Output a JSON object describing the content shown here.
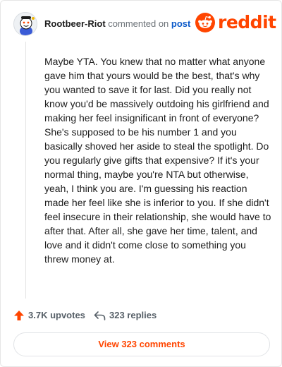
{
  "colors": {
    "brand": "#ff4500",
    "link": "#0b59c9",
    "muted": "#576068"
  },
  "header": {
    "avatar_icon": "snoo-avatar-icon",
    "author": "Rootbeer-Riot",
    "commented_text": "commented on",
    "post_link": "post",
    "logo_icon": "reddit-snoo-icon",
    "logo_text": "reddit"
  },
  "comment": {
    "body": "Maybe YTA. You knew that no matter what anyone gave him that yours would be the best, that's why you wanted to save it for last. Did you really not know you'd be massively outdoing his girlfriend and making her feel insignificant in front of everyone? She's supposed to be his number 1 and you basically shoved her aside to steal the spotlight. Do you regularly give gifts that expensive? If it's your normal thing, maybe you're NTA but otherwise, yeah, I think you are. I'm guessing his reaction made her feel like she is inferior to you. If she didn't feel insecure in their relationship, she would have to after that. After all, she gave her time, talent, and love and it didn't come close to something you threw money at."
  },
  "actions": {
    "upvote_icon": "upvote-arrow-icon",
    "upvotes_label": "3.7K upvotes",
    "reply_icon": "reply-arrow-icon",
    "replies_label": "323 replies"
  },
  "footer": {
    "view_button_label": "View 323 comments"
  }
}
